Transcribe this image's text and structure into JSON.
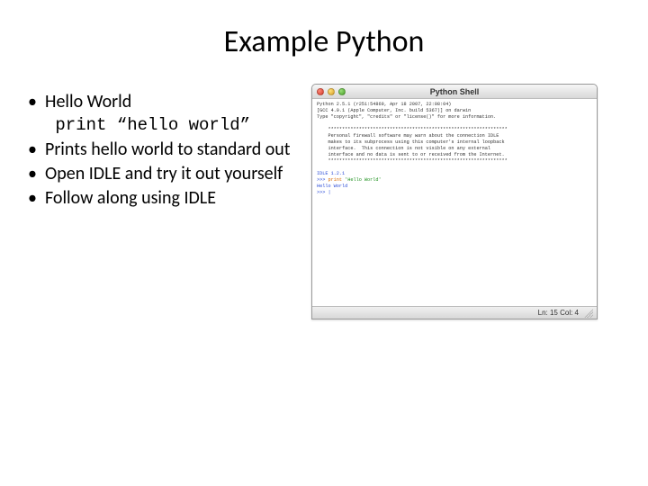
{
  "title": "Example Python",
  "bullets": [
    {
      "text": "Hello World",
      "code": " print “hello world”"
    },
    {
      "text": "Prints hello world to standard out"
    },
    {
      "text": "Open IDLE and try it out yourself"
    },
    {
      "text": "Follow along using IDLE"
    }
  ],
  "shell": {
    "window_title": "Python Shell",
    "header1": "Python 2.5.1 (r251:54869, Apr 18 2007, 22:08:04)",
    "header2": "[GCC 4.0.1 (Apple Computer, Inc. build 5367)] on darwin",
    "header3": "Type \"copyright\", \"credits\" or \"license()\" for more information.",
    "divider": "    ****************************************************************",
    "warn1": "    Personal firewall software may warn about the connection IDLE",
    "warn2": "    makes to its subprocess using this computer's internal loopback",
    "warn3": "    interface.  This connection is not visible on any external",
    "warn4": "    interface and no data is sent to or received from the Internet.",
    "idle_ver": "IDLE 1.2.1",
    "prompt": ">>> ",
    "stmt_kw": "print",
    "stmt_str": " 'Hello World'",
    "output": "Hello World",
    "cursor_prompt": ">>> |",
    "status": "Ln: 15 Col: 4"
  }
}
